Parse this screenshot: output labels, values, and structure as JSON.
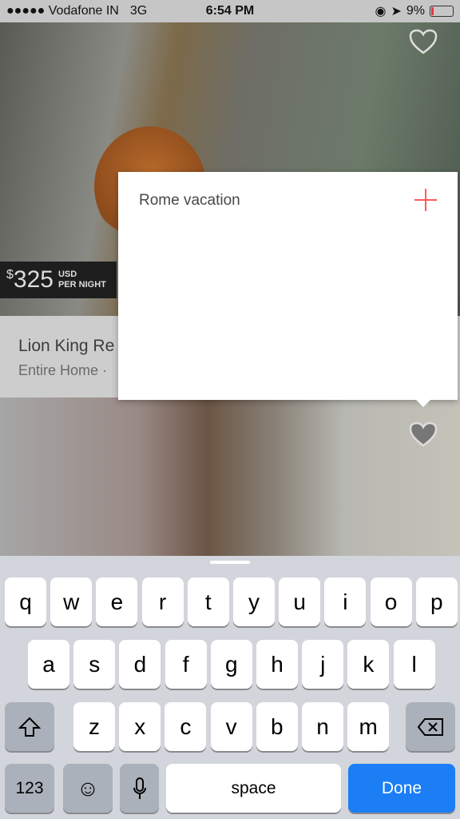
{
  "status": {
    "carrier": "●●●●● Vodafone IN",
    "network": "3G",
    "time": "6:54 PM",
    "battery": "9%"
  },
  "listing": {
    "price": "325",
    "currency_symbol": "$",
    "currency": "USD",
    "per": "PER NIGHT",
    "title": "Lion King Re",
    "subtitle": "Entire Home ·"
  },
  "popup": {
    "input_value": "Rome vacation"
  },
  "keyboard": {
    "row1": [
      "q",
      "w",
      "e",
      "r",
      "t",
      "y",
      "u",
      "i",
      "o",
      "p"
    ],
    "row2": [
      "a",
      "s",
      "d",
      "f",
      "g",
      "h",
      "j",
      "k",
      "l"
    ],
    "row3": [
      "z",
      "x",
      "c",
      "v",
      "b",
      "n",
      "m"
    ],
    "numbers": "123",
    "space": "space",
    "done": "Done"
  },
  "colors": {
    "accent": "#ff5a5f",
    "done": "#1b7ef5"
  }
}
